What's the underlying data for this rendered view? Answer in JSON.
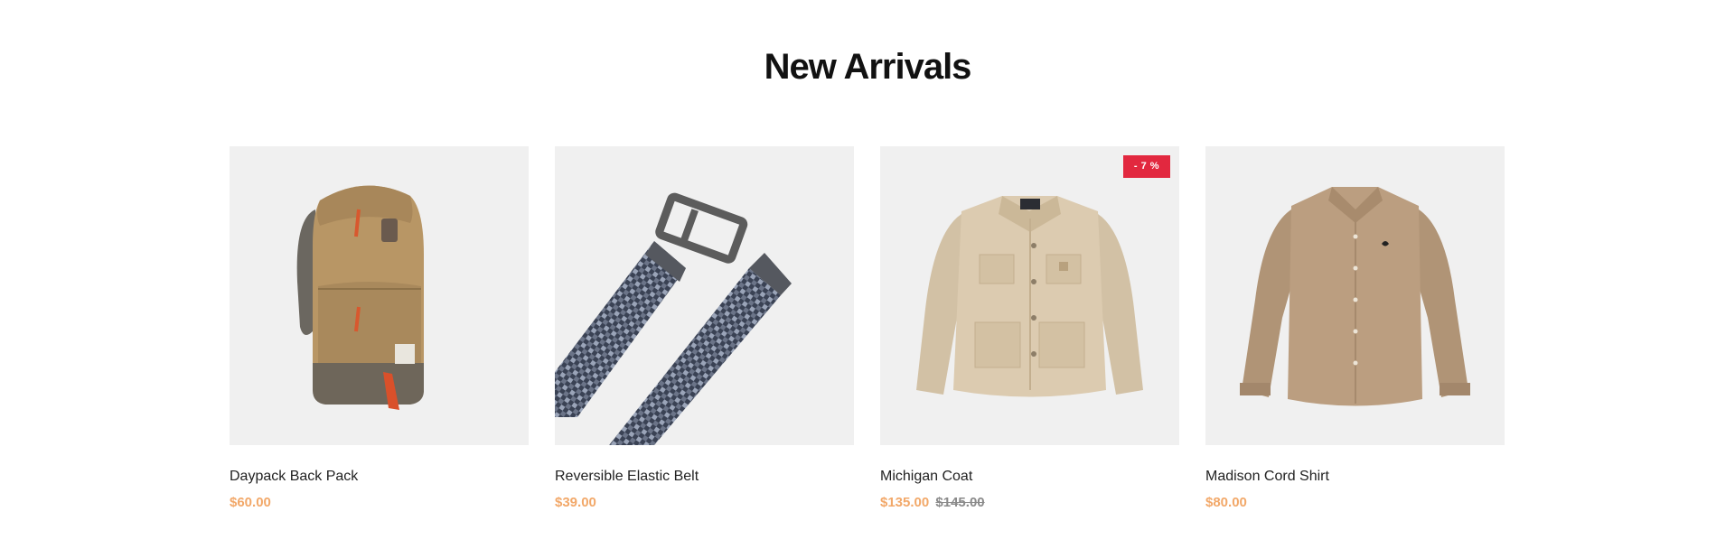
{
  "section": {
    "title": "New Arrivals"
  },
  "colors": {
    "price": "#f2a869",
    "old_price": "#8a8a8a",
    "badge": "#e2283f",
    "image_bg": "#f0f0f0"
  },
  "products": [
    {
      "name": "Daypack Back Pack",
      "price": "$60.00",
      "old_price": "",
      "badge": "",
      "image": "backpack-image"
    },
    {
      "name": "Reversible Elastic Belt",
      "price": "$39.00",
      "old_price": "",
      "badge": "",
      "image": "belt-image"
    },
    {
      "name": "Michigan Coat",
      "price": "$135.00",
      "old_price": "$145.00",
      "badge": "- 7 %",
      "image": "coat-image"
    },
    {
      "name": "Madison Cord Shirt",
      "price": "$80.00",
      "old_price": "",
      "badge": "",
      "image": "shirt-image"
    }
  ]
}
